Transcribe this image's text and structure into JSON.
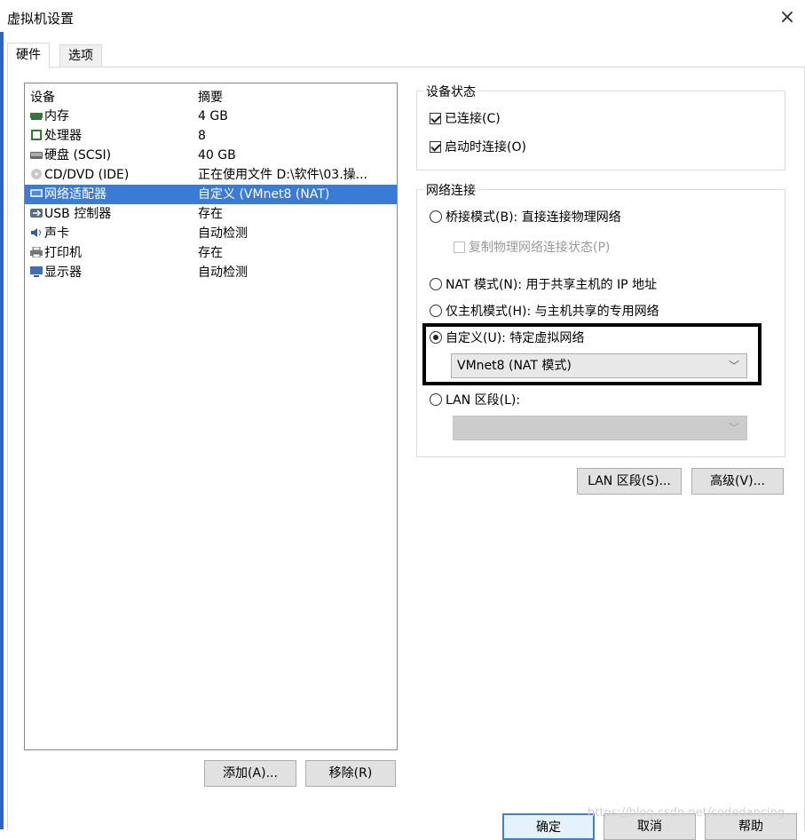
{
  "window": {
    "title": "虚拟机设置",
    "close_glyph": "×"
  },
  "tabs": [
    {
      "label": "硬件",
      "active": true
    },
    {
      "label": "选项",
      "active": false
    }
  ],
  "device_list": {
    "headers": {
      "device": "设备",
      "summary": "摘要"
    },
    "rows": [
      {
        "device": "内存",
        "summary": "4 GB",
        "icon": "memory-icon"
      },
      {
        "device": "处理器",
        "summary": "8",
        "icon": "processor-icon"
      },
      {
        "device": "硬盘 (SCSI)",
        "summary": "40 GB",
        "icon": "hard-disk-icon"
      },
      {
        "device": "CD/DVD (IDE)",
        "summary": "正在使用文件 D:\\软件\\03.操...",
        "icon": "cd-dvd-icon"
      },
      {
        "device": "网络适配器",
        "summary": "自定义 (VMnet8 (NAT)",
        "icon": "network-adapter-icon",
        "selected": true
      },
      {
        "device": "USB 控制器",
        "summary": "存在",
        "icon": "usb-icon"
      },
      {
        "device": "声卡",
        "summary": "自动检测",
        "icon": "sound-card-icon"
      },
      {
        "device": "打印机",
        "summary": "存在",
        "icon": "printer-icon"
      },
      {
        "device": "显示器",
        "summary": "自动检测",
        "icon": "display-icon"
      }
    ],
    "add_label": "添加(A)...",
    "remove_label": "移除(R)"
  },
  "device_status": {
    "legend": "设备状态",
    "connected": {
      "label": "已连接(C)",
      "checked": true
    },
    "connect_on_power": {
      "label": "启动时连接(O)",
      "checked": true
    }
  },
  "network": {
    "legend": "网络连接",
    "bridged": {
      "label": "桥接模式(B): 直接连接物理网络",
      "selected": false
    },
    "replicate": {
      "label": "复制物理网络连接状态(P)",
      "checked": false,
      "disabled": true
    },
    "nat": {
      "label": "NAT 模式(N): 用于共享主机的 IP 地址",
      "selected": false
    },
    "host_only": {
      "label": "仅主机模式(H): 与主机共享的专用网络",
      "selected": false
    },
    "custom": {
      "label": "自定义(U): 特定虚拟网络",
      "selected": true
    },
    "custom_select_value": "VMnet8 (NAT 模式)",
    "lan": {
      "label": "LAN 区段(L):",
      "selected": false
    },
    "lan_select_value": ""
  },
  "buttons": {
    "lan_segment": "LAN 区段(S)...",
    "advanced": "高级(V)...",
    "ok": "确定",
    "cancel": "取消",
    "help": "帮助"
  },
  "watermark": "https://blog.csdn.net/codedancing",
  "colors": {
    "selection": "#3b7bd8",
    "accent": "#3c7fd6"
  }
}
